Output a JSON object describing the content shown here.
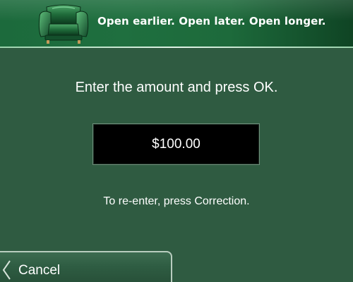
{
  "banner": {
    "tagline": "Open earlier. Open later. Open longer.",
    "logo_icon": "armchair-icon"
  },
  "main": {
    "prompt": "Enter the amount and press OK.",
    "amount": "$100.00",
    "hint": "To re-enter, press Correction."
  },
  "actions": {
    "cancel_label": "Cancel",
    "cancel_icon": "left-arrow-icon"
  },
  "colors": {
    "background": "#2f5b41",
    "banner": "#1f6f3f",
    "amount_box": "#000000",
    "text": "#ffffff"
  }
}
